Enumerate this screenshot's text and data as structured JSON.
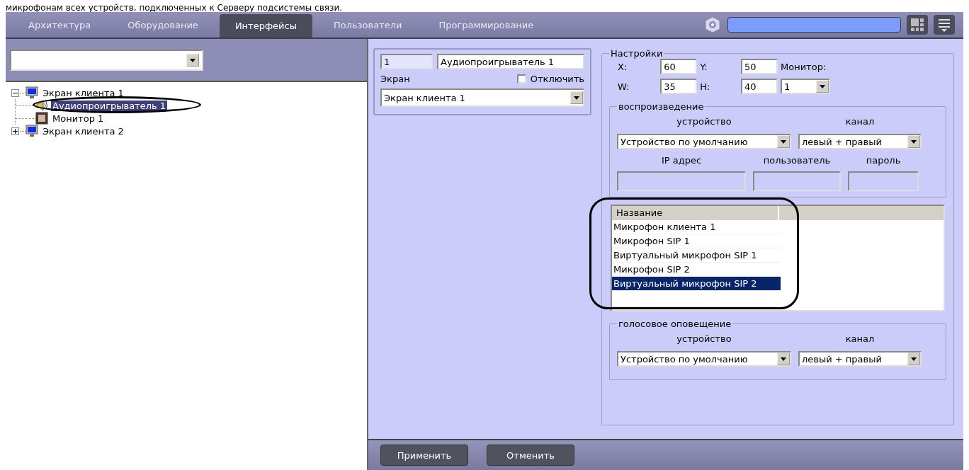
{
  "caption": "микрофонам всех  устройств, подключенных к Серверу подсистемы связи.",
  "tabs": [
    {
      "label": "Архитектура",
      "selected": false
    },
    {
      "label": "Оборудование",
      "selected": false
    },
    {
      "label": "Интерфейсы",
      "selected": true
    },
    {
      "label": "Пользователи",
      "selected": false
    },
    {
      "label": "Программирование",
      "selected": false
    }
  ],
  "tree": [
    {
      "label": "Экран клиента 1",
      "kind": "screen",
      "expanded": true,
      "selected": false,
      "children": [
        {
          "label": "Аудиопроигрыватель 1",
          "kind": "speaker",
          "selected": true
        },
        {
          "label": "Монитор 1",
          "kind": "monitor",
          "selected": false
        }
      ]
    },
    {
      "label": "Экран клиента 2",
      "kind": "screen",
      "expanded": false,
      "selected": false
    }
  ],
  "object": {
    "id": "1",
    "name": "Аудиопроигрыватель 1",
    "screen_label": "Экран",
    "disable": {
      "label": "Отключить",
      "checked": false
    },
    "screen": "Экран клиента 1"
  },
  "settings": {
    "title": "Настройки",
    "fields": [
      {
        "label": "X:",
        "value": "60"
      },
      {
        "label": "Y:",
        "value": "50"
      },
      {
        "label": "W:",
        "value": "35"
      },
      {
        "label": "H:",
        "value": "40"
      }
    ],
    "monitor_label": "Монитор:",
    "monitor": "1"
  },
  "playback": {
    "title": "воспроизведение",
    "device_label": "устройство",
    "channel_label": "канал",
    "device": "Устройство по умолчанию",
    "channel": "левый + правый",
    "ip_label": "IP адрес",
    "user_label": "пользователь",
    "password_label": "пароль"
  },
  "microphones": {
    "columns": [
      "Название"
    ],
    "rows": [
      {
        "name": "Микрофон клиента 1",
        "selected": false
      },
      {
        "name": "Микрофон SIP 1",
        "selected": false
      },
      {
        "name": "Виртуальный микрофон SIP 1",
        "selected": false
      },
      {
        "name": "Микрофон SIP 2",
        "selected": false
      },
      {
        "name": "Виртуальный микрофон SIP 2",
        "selected": true
      }
    ]
  },
  "voice": {
    "title": "голосовое оповещение",
    "device_label": "устройство",
    "channel_label": "канал",
    "device": "Устройство по умолчанию",
    "channel": "левый + правый"
  },
  "buttons": [
    "Применить",
    "Отменить"
  ]
}
